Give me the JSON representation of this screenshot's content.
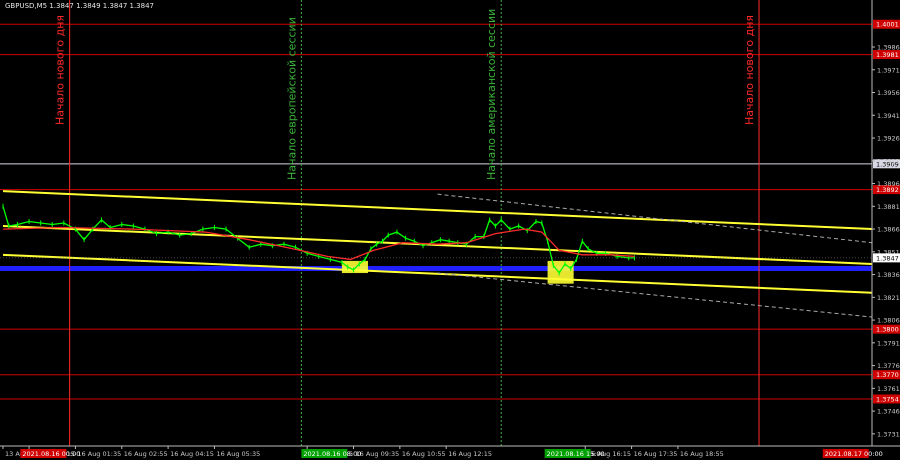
{
  "chart_data": {
    "type": "line",
    "symbol_header": "GBPUSD,M5  1.3847 1.3849 1.3847 1.3847",
    "colors": {
      "background": "#000000",
      "price": "#00ff00",
      "ma": "#ff2a2a",
      "channel": "#ffff33",
      "support_blue": "#2020ff",
      "level_red": "#d00000",
      "level_white": "#d8d8e6",
      "session_line": "#3cb33c",
      "day_line": "#ff0000",
      "signal_box": "#ffff33"
    },
    "y_axis": {
      "range": [
        1.3723,
        1.4015
      ],
      "ticks": [
        "1.3986",
        "1.3971",
        "1.3956",
        "1.3941",
        "1.3926",
        "1.3911",
        "1.3896",
        "1.3881",
        "1.3866",
        "1.3851",
        "1.3836",
        "1.3821",
        "1.3806",
        "1.3791",
        "1.3776",
        "1.3761",
        "1.3746",
        "1.3731"
      ],
      "current_price": "1.3847"
    },
    "x_axis": {
      "ticks": [
        {
          "label": "13 Aug 2021",
          "bar": 0
        },
        {
          "label": "16 Aug 00:15",
          "bar": 9
        },
        {
          "label": "16 Aug 01:35",
          "bar": 25
        },
        {
          "label": "16 Aug 02:55",
          "bar": 41
        },
        {
          "label": "16 Aug 04:15",
          "bar": 57
        },
        {
          "label": "16 Aug 05:35",
          "bar": 73
        },
        {
          "label": "16 Aug 08:15",
          "bar": 105
        },
        {
          "label": "16 Aug 09:35",
          "bar": 121
        },
        {
          "label": "16 Aug 10:55",
          "bar": 137
        },
        {
          "label": "16 Aug 12:15",
          "bar": 153
        },
        {
          "label": "16 Aug 16:15",
          "bar": 201
        },
        {
          "label": "16 Aug 17:35",
          "bar": 217
        },
        {
          "label": "16 Aug 18:55",
          "bar": 233
        }
      ],
      "highlight_labels": [
        {
          "label": "2021.08.16 00:00",
          "bar": 6,
          "color": "#d00000"
        },
        {
          "label": "2021.08.16 08:00",
          "bar": 103,
          "color": "#00a000"
        },
        {
          "label": "2021.08.16 15:00",
          "bar": 187,
          "color": "#00a000"
        },
        {
          "label": "2021.08.17 00:00",
          "bar": 283,
          "color": "#d00000"
        }
      ],
      "total_bars": 300
    },
    "horizontal_levels": [
      {
        "value": 1.4001,
        "label": "1.4001",
        "color": "#d00000"
      },
      {
        "value": 1.3981,
        "label": "1.3981",
        "color": "#d00000"
      },
      {
        "value": 1.3909,
        "label": "1.3909",
        "color": "#d8d8e6"
      },
      {
        "value": 1.3892,
        "label": "1.3892",
        "color": "#d00000"
      },
      {
        "value": 1.384,
        "label": "",
        "color": "#2020ff"
      },
      {
        "value": 1.38,
        "label": "1.3800",
        "color": "#d00000"
      },
      {
        "value": 1.377,
        "label": "1.3770",
        "color": "#d00000"
      },
      {
        "value": 1.3754,
        "label": "1.3754",
        "color": "#d00000"
      }
    ],
    "trend_channel": {
      "upper": {
        "from": [
          0,
          1.3891
        ],
        "to": [
          300,
          1.3866
        ]
      },
      "middle": {
        "from": [
          0,
          1.3868
        ],
        "to": [
          300,
          1.3843
        ]
      },
      "lower": {
        "from": [
          0,
          1.3849
        ],
        "to": [
          300,
          1.3824
        ]
      },
      "dashed_upper": {
        "from": [
          150,
          1.3889
        ],
        "to": [
          300,
          1.3857
        ]
      },
      "dashed_lower": {
        "from": [
          150,
          1.3837
        ],
        "to": [
          300,
          1.3808
        ]
      }
    },
    "vertical_markers": [
      {
        "bar": 23,
        "text": "Начало нового дня",
        "color": "#ff2a2a",
        "style": "solid"
      },
      {
        "bar": 103,
        "text": "Начало европейской сессии",
        "color": "#3cb33c",
        "style": "dotted"
      },
      {
        "bar": 172,
        "text": "Начало американской сессии",
        "color": "#3cb33c",
        "style": "dotted"
      },
      {
        "bar": 261,
        "text": "Начало нового дня",
        "color": "#ff2a2a",
        "style": "solid"
      }
    ],
    "signal_boxes": [
      {
        "bar_from": 117,
        "bar_to": 126,
        "price_top": 1.3845,
        "price_bottom": 1.3837
      },
      {
        "bar_from": 188,
        "bar_to": 197,
        "price_top": 1.3845,
        "price_bottom": 1.383
      }
    ],
    "price_series": [
      [
        0,
        1.3881
      ],
      [
        2,
        1.3868
      ],
      [
        5,
        1.3869
      ],
      [
        9,
        1.3871
      ],
      [
        13,
        1.387
      ],
      [
        17,
        1.3869
      ],
      [
        21,
        1.387
      ],
      [
        25,
        1.3866
      ],
      [
        28,
        1.3859
      ],
      [
        31,
        1.3866
      ],
      [
        34,
        1.3872
      ],
      [
        37,
        1.3867
      ],
      [
        41,
        1.3869
      ],
      [
        45,
        1.3868
      ],
      [
        49,
        1.3866
      ],
      [
        53,
        1.3863
      ],
      [
        57,
        1.3864
      ],
      [
        61,
        1.3862
      ],
      [
        65,
        1.3863
      ],
      [
        69,
        1.3866
      ],
      [
        73,
        1.3867
      ],
      [
        77,
        1.3866
      ],
      [
        81,
        1.386
      ],
      [
        85,
        1.3854
      ],
      [
        89,
        1.3856
      ],
      [
        93,
        1.3855
      ],
      [
        97,
        1.3856
      ],
      [
        101,
        1.3854
      ],
      [
        105,
        1.385
      ],
      [
        109,
        1.3848
      ],
      [
        113,
        1.3846
      ],
      [
        117,
        1.3844
      ],
      [
        119,
        1.3841
      ],
      [
        121,
        1.3839
      ],
      [
        123,
        1.3843
      ],
      [
        125,
        1.3846
      ],
      [
        127,
        1.3853
      ],
      [
        129,
        1.3856
      ],
      [
        131,
        1.3858
      ],
      [
        133,
        1.3862
      ],
      [
        136,
        1.3864
      ],
      [
        139,
        1.386
      ],
      [
        142,
        1.3858
      ],
      [
        145,
        1.3855
      ],
      [
        148,
        1.3857
      ],
      [
        151,
        1.3859
      ],
      [
        154,
        1.3858
      ],
      [
        157,
        1.3857
      ],
      [
        160,
        1.3856
      ],
      [
        163,
        1.3861
      ],
      [
        166,
        1.3861
      ],
      [
        168,
        1.3872
      ],
      [
        170,
        1.3868
      ],
      [
        172,
        1.3872
      ],
      [
        175,
        1.3866
      ],
      [
        178,
        1.3868
      ],
      [
        181,
        1.3865
      ],
      [
        184,
        1.3871
      ],
      [
        186,
        1.387
      ],
      [
        188,
        1.3858
      ],
      [
        190,
        1.3842
      ],
      [
        192,
        1.3837
      ],
      [
        194,
        1.3843
      ],
      [
        196,
        1.384
      ],
      [
        198,
        1.3846
      ],
      [
        200,
        1.3858
      ],
      [
        202,
        1.3853
      ],
      [
        205,
        1.385
      ],
      [
        208,
        1.385
      ],
      [
        212,
        1.3848
      ],
      [
        216,
        1.3847
      ],
      [
        218,
        1.3847
      ]
    ],
    "ma_series": [
      [
        0,
        1.3866
      ],
      [
        20,
        1.3867
      ],
      [
        45,
        1.3866
      ],
      [
        70,
        1.3864
      ],
      [
        85,
        1.3859
      ],
      [
        100,
        1.3853
      ],
      [
        112,
        1.3848
      ],
      [
        120,
        1.3846
      ],
      [
        128,
        1.3852
      ],
      [
        138,
        1.3857
      ],
      [
        150,
        1.3856
      ],
      [
        160,
        1.3857
      ],
      [
        170,
        1.3863
      ],
      [
        180,
        1.3866
      ],
      [
        186,
        1.3864
      ],
      [
        192,
        1.3852
      ],
      [
        200,
        1.3849
      ],
      [
        210,
        1.3849
      ],
      [
        218,
        1.3848
      ]
    ]
  }
}
